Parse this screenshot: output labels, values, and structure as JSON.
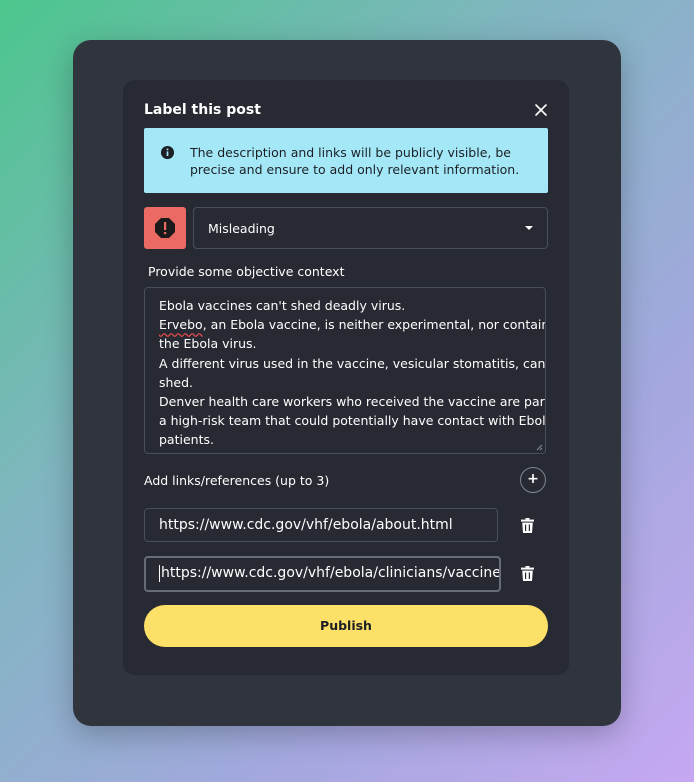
{
  "dialog": {
    "title": "Label this post",
    "info_text": "The description and links will be publicly visible, be precise and ensure to add only relevant information.",
    "label_select": {
      "value": "Misleading"
    },
    "context_label": "Provide some objective context",
    "context_lines": {
      "l1": "Ebola vaccines can't shed deadly virus.",
      "l2_word": "Ervebo",
      "l2_rest": ", an Ebola vaccine, is neither experimental, nor contains",
      "l3": "the Ebola virus.",
      "l4": "A different virus used in the vaccine, vesicular stomatitis, can",
      "l5": "shed.",
      "l6": "Denver health care workers who received the vaccine are part of",
      "l7": "a high-risk team that could potentially have contact with Ebola",
      "l8": "patients."
    },
    "links_label": "Add links/references (up to 3)",
    "add_link_symbol": "+",
    "links": [
      {
        "value": "https://www.cdc.gov/vhf/ebola/about.html"
      },
      {
        "value": "https://www.cdc.gov/vhf/ebola/clinicians/vaccine/i"
      }
    ],
    "publish_label": "Publish"
  },
  "colors": {
    "info_bg": "#a4e8f8",
    "warning": "#ec6a64",
    "publish": "#fde067",
    "modal_bg": "#272a32"
  },
  "icons": [
    "close-icon",
    "info-icon",
    "warning-icon",
    "chevron-down-icon",
    "plus-icon",
    "trash-icon"
  ]
}
